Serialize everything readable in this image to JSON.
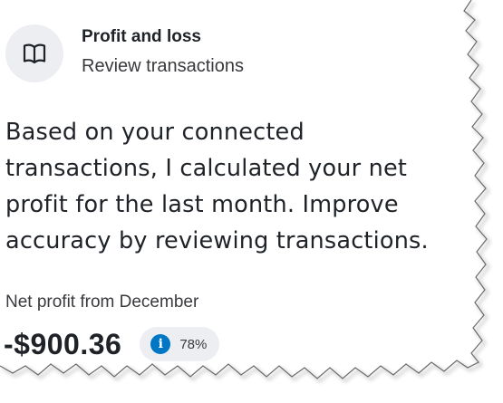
{
  "header": {
    "icon": "book-icon",
    "title": "Profit and loss",
    "subtitle": "Review transactions"
  },
  "body": {
    "lines": [
      "Based on your connected",
      "transactions, I calculated your net",
      "profit for the last month. Improve",
      "accuracy by reviewing transactions."
    ]
  },
  "metric": {
    "label": "Net profit from December",
    "value": "-$900.36",
    "confidence_icon": "info-icon",
    "confidence": "78%"
  },
  "colors": {
    "accent": "#0077c5",
    "badge_bg": "#eceef1",
    "text": "#1f2328"
  }
}
